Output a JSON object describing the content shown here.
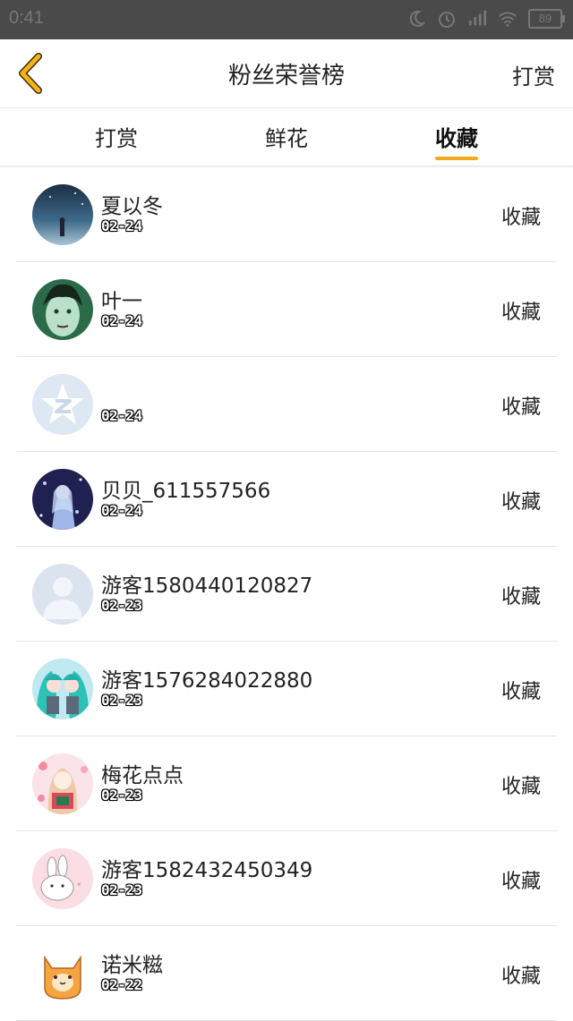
{
  "status_bar": {
    "time": "0:41",
    "battery": "89"
  },
  "header": {
    "back_icon": "chevron-left-icon",
    "title": "粉丝荣誉榜",
    "action_label": "打赏",
    "accent_color": "#f2a91f"
  },
  "tabs": [
    {
      "label": "打赏",
      "active": false
    },
    {
      "label": "鲜花",
      "active": false
    },
    {
      "label": "收藏",
      "active": true
    }
  ],
  "fans": [
    {
      "name": "夏以冬",
      "date": "02-24",
      "type": "收藏",
      "avatar": "night-sky"
    },
    {
      "name": "叶一",
      "date": "02-24",
      "type": "收藏",
      "avatar": "green-face"
    },
    {
      "name": "",
      "date": "02-24",
      "type": "收藏",
      "avatar": "qzone-star"
    },
    {
      "name": "贝贝_611557566",
      "date": "02-24",
      "type": "收藏",
      "avatar": "anime-girl-dark"
    },
    {
      "name": "游客1580440120827",
      "date": "02-23",
      "type": "收藏",
      "avatar": "default-person"
    },
    {
      "name": "游客1576284022880",
      "date": "02-23",
      "type": "收藏",
      "avatar": "anime-teal"
    },
    {
      "name": "梅花点点",
      "date": "02-23",
      "type": "收藏",
      "avatar": "anime-pink"
    },
    {
      "name": "游客1582432450349",
      "date": "02-23",
      "type": "收藏",
      "avatar": "white-rabbit"
    },
    {
      "name": "诺米糍",
      "date": "02-22",
      "type": "收藏",
      "avatar": "orange-cat"
    }
  ]
}
